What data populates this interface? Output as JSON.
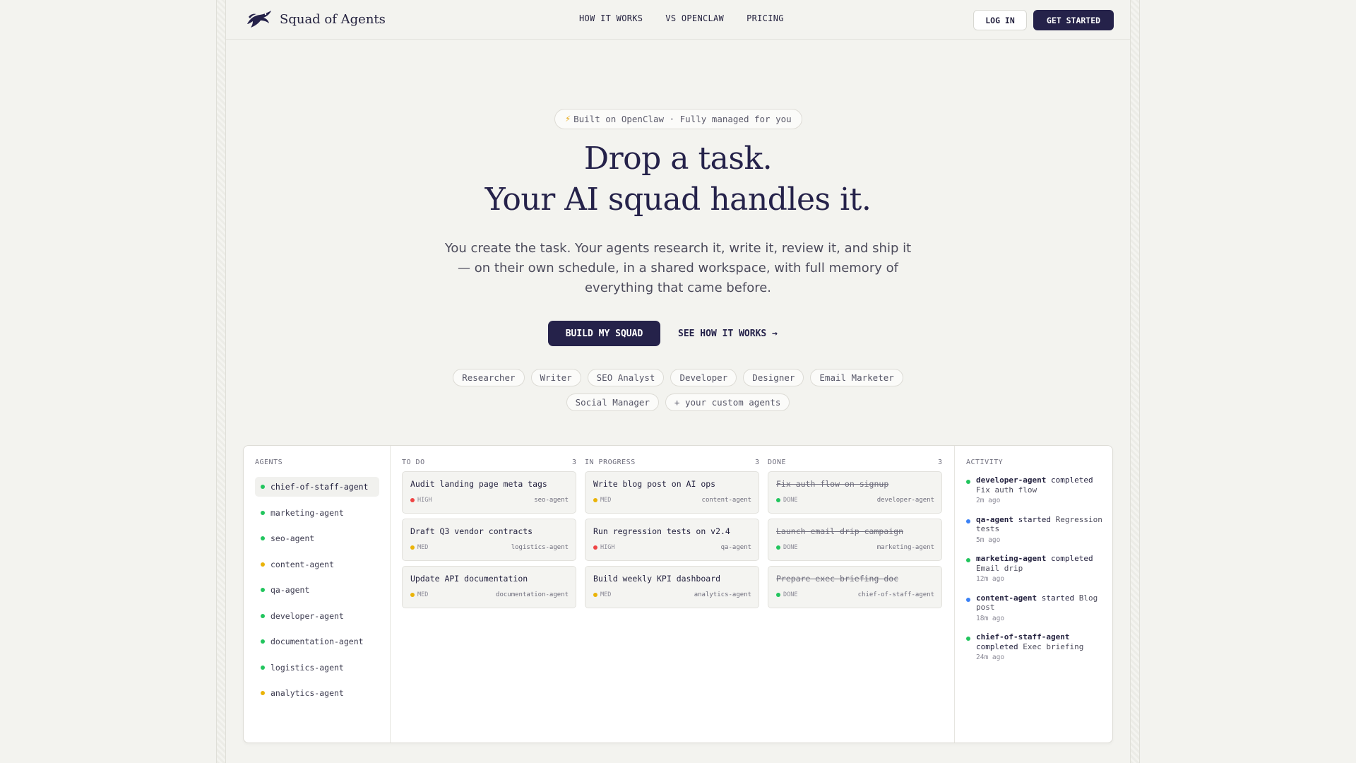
{
  "nav": {
    "brand": "Squad of Agents",
    "links": [
      "HOW IT WORKS",
      "VS OPENCLAW",
      "PRICING"
    ],
    "login": "LOG IN",
    "get_started": "GET STARTED"
  },
  "hero": {
    "badge": "Built on OpenClaw · Fully managed for you",
    "title_line1": "Drop a task.",
    "title_line2": "Your AI squad handles it.",
    "subtitle": "You create the task. Your agents research it, write it, review it, and ship it — on their own schedule, in a shared workspace, with full memory of everything that came before.",
    "cta_primary": "BUILD MY SQUAD",
    "cta_secondary": "SEE HOW IT WORKS →",
    "roles": [
      "Researcher",
      "Writer",
      "SEO Analyst",
      "Developer",
      "Designer",
      "Email Marketer",
      "Social Manager",
      "+ your custom agents"
    ]
  },
  "dashboard": {
    "agents_label": "AGENTS",
    "agents": [
      {
        "name": "chief-of-staff-agent",
        "status": "green",
        "active": true
      },
      {
        "name": "marketing-agent",
        "status": "green"
      },
      {
        "name": "seo-agent",
        "status": "green"
      },
      {
        "name": "content-agent",
        "status": "yellow"
      },
      {
        "name": "qa-agent",
        "status": "green"
      },
      {
        "name": "developer-agent",
        "status": "green"
      },
      {
        "name": "documentation-agent",
        "status": "green"
      },
      {
        "name": "logistics-agent",
        "status": "green"
      },
      {
        "name": "analytics-agent",
        "status": "yellow"
      }
    ],
    "columns": [
      {
        "label": "TO DO",
        "count": "3",
        "tasks": [
          {
            "title": "Audit landing page meta tags",
            "priority": "HIGH",
            "color": "red",
            "agent": "seo-agent"
          },
          {
            "title": "Draft Q3 vendor contracts",
            "priority": "MED",
            "color": "yellow",
            "agent": "logistics-agent"
          },
          {
            "title": "Update API documentation",
            "priority": "MED",
            "color": "yellow",
            "agent": "documentation-agent"
          }
        ]
      },
      {
        "label": "IN PROGRESS",
        "count": "3",
        "tasks": [
          {
            "title": "Write blog post on AI ops",
            "priority": "MED",
            "color": "yellow",
            "agent": "content-agent"
          },
          {
            "title": "Run regression tests on v2.4",
            "priority": "HIGH",
            "color": "red",
            "agent": "qa-agent"
          },
          {
            "title": "Build weekly KPI dashboard",
            "priority": "MED",
            "color": "yellow",
            "agent": "analytics-agent"
          }
        ]
      },
      {
        "label": "DONE",
        "count": "3",
        "done": true,
        "tasks": [
          {
            "title": "Fix auth flow on signup",
            "priority": "DONE",
            "color": "green",
            "agent": "developer-agent"
          },
          {
            "title": "Launch email drip campaign",
            "priority": "DONE",
            "color": "green",
            "agent": "marketing-agent"
          },
          {
            "title": "Prepare exec briefing doc",
            "priority": "DONE",
            "color": "green",
            "agent": "chief-of-staff-agent"
          }
        ]
      }
    ],
    "activity_label": "ACTIVITY",
    "activity": [
      {
        "agent": "developer-agent",
        "verb": "completed",
        "task": "Fix auth flow",
        "time": "2m ago",
        "color": "green"
      },
      {
        "agent": "qa-agent",
        "verb": "started",
        "task": "Regression tests",
        "time": "5m ago",
        "color": "blue"
      },
      {
        "agent": "marketing-agent",
        "verb": "completed",
        "task": "Email drip",
        "time": "12m ago",
        "color": "green"
      },
      {
        "agent": "content-agent",
        "verb": "started",
        "task": "Blog post",
        "time": "18m ago",
        "color": "blue"
      },
      {
        "agent": "chief-of-staff-agent",
        "verb": "completed",
        "task": "Exec briefing",
        "time": "24m ago",
        "color": "green"
      }
    ]
  }
}
